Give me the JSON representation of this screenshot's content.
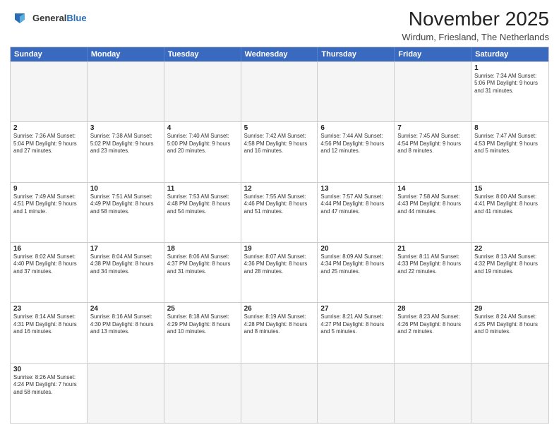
{
  "header": {
    "logo_general": "General",
    "logo_blue": "Blue",
    "title": "November 2025",
    "subtitle": "Wirdum, Friesland, The Netherlands"
  },
  "weekdays": [
    "Sunday",
    "Monday",
    "Tuesday",
    "Wednesday",
    "Thursday",
    "Friday",
    "Saturday"
  ],
  "weeks": [
    [
      {
        "day": "",
        "empty": true
      },
      {
        "day": "",
        "empty": true
      },
      {
        "day": "",
        "empty": true
      },
      {
        "day": "",
        "empty": true
      },
      {
        "day": "",
        "empty": true
      },
      {
        "day": "",
        "empty": true
      },
      {
        "day": "1",
        "info": "Sunrise: 7:34 AM\nSunset: 5:06 PM\nDaylight: 9 hours\nand 31 minutes."
      }
    ],
    [
      {
        "day": "2",
        "info": "Sunrise: 7:36 AM\nSunset: 5:04 PM\nDaylight: 9 hours\nand 27 minutes."
      },
      {
        "day": "3",
        "info": "Sunrise: 7:38 AM\nSunset: 5:02 PM\nDaylight: 9 hours\nand 23 minutes."
      },
      {
        "day": "4",
        "info": "Sunrise: 7:40 AM\nSunset: 5:00 PM\nDaylight: 9 hours\nand 20 minutes."
      },
      {
        "day": "5",
        "info": "Sunrise: 7:42 AM\nSunset: 4:58 PM\nDaylight: 9 hours\nand 16 minutes."
      },
      {
        "day": "6",
        "info": "Sunrise: 7:44 AM\nSunset: 4:56 PM\nDaylight: 9 hours\nand 12 minutes."
      },
      {
        "day": "7",
        "info": "Sunrise: 7:45 AM\nSunset: 4:54 PM\nDaylight: 9 hours\nand 8 minutes."
      },
      {
        "day": "8",
        "info": "Sunrise: 7:47 AM\nSunset: 4:53 PM\nDaylight: 9 hours\nand 5 minutes."
      }
    ],
    [
      {
        "day": "9",
        "info": "Sunrise: 7:49 AM\nSunset: 4:51 PM\nDaylight: 9 hours\nand 1 minute."
      },
      {
        "day": "10",
        "info": "Sunrise: 7:51 AM\nSunset: 4:49 PM\nDaylight: 8 hours\nand 58 minutes."
      },
      {
        "day": "11",
        "info": "Sunrise: 7:53 AM\nSunset: 4:48 PM\nDaylight: 8 hours\nand 54 minutes."
      },
      {
        "day": "12",
        "info": "Sunrise: 7:55 AM\nSunset: 4:46 PM\nDaylight: 8 hours\nand 51 minutes."
      },
      {
        "day": "13",
        "info": "Sunrise: 7:57 AM\nSunset: 4:44 PM\nDaylight: 8 hours\nand 47 minutes."
      },
      {
        "day": "14",
        "info": "Sunrise: 7:58 AM\nSunset: 4:43 PM\nDaylight: 8 hours\nand 44 minutes."
      },
      {
        "day": "15",
        "info": "Sunrise: 8:00 AM\nSunset: 4:41 PM\nDaylight: 8 hours\nand 41 minutes."
      }
    ],
    [
      {
        "day": "16",
        "info": "Sunrise: 8:02 AM\nSunset: 4:40 PM\nDaylight: 8 hours\nand 37 minutes."
      },
      {
        "day": "17",
        "info": "Sunrise: 8:04 AM\nSunset: 4:38 PM\nDaylight: 8 hours\nand 34 minutes."
      },
      {
        "day": "18",
        "info": "Sunrise: 8:06 AM\nSunset: 4:37 PM\nDaylight: 8 hours\nand 31 minutes."
      },
      {
        "day": "19",
        "info": "Sunrise: 8:07 AM\nSunset: 4:36 PM\nDaylight: 8 hours\nand 28 minutes."
      },
      {
        "day": "20",
        "info": "Sunrise: 8:09 AM\nSunset: 4:34 PM\nDaylight: 8 hours\nand 25 minutes."
      },
      {
        "day": "21",
        "info": "Sunrise: 8:11 AM\nSunset: 4:33 PM\nDaylight: 8 hours\nand 22 minutes."
      },
      {
        "day": "22",
        "info": "Sunrise: 8:13 AM\nSunset: 4:32 PM\nDaylight: 8 hours\nand 19 minutes."
      }
    ],
    [
      {
        "day": "23",
        "info": "Sunrise: 8:14 AM\nSunset: 4:31 PM\nDaylight: 8 hours\nand 16 minutes."
      },
      {
        "day": "24",
        "info": "Sunrise: 8:16 AM\nSunset: 4:30 PM\nDaylight: 8 hours\nand 13 minutes."
      },
      {
        "day": "25",
        "info": "Sunrise: 8:18 AM\nSunset: 4:29 PM\nDaylight: 8 hours\nand 10 minutes."
      },
      {
        "day": "26",
        "info": "Sunrise: 8:19 AM\nSunset: 4:28 PM\nDaylight: 8 hours\nand 8 minutes."
      },
      {
        "day": "27",
        "info": "Sunrise: 8:21 AM\nSunset: 4:27 PM\nDaylight: 8 hours\nand 5 minutes."
      },
      {
        "day": "28",
        "info": "Sunrise: 8:23 AM\nSunset: 4:26 PM\nDaylight: 8 hours\nand 2 minutes."
      },
      {
        "day": "29",
        "info": "Sunrise: 8:24 AM\nSunset: 4:25 PM\nDaylight: 8 hours\nand 0 minutes."
      }
    ],
    [
      {
        "day": "30",
        "info": "Sunrise: 8:26 AM\nSunset: 4:24 PM\nDaylight: 7 hours\nand 58 minutes."
      },
      {
        "day": "",
        "empty": true
      },
      {
        "day": "",
        "empty": true
      },
      {
        "day": "",
        "empty": true
      },
      {
        "day": "",
        "empty": true
      },
      {
        "day": "",
        "empty": true
      },
      {
        "day": "",
        "empty": true
      }
    ]
  ]
}
